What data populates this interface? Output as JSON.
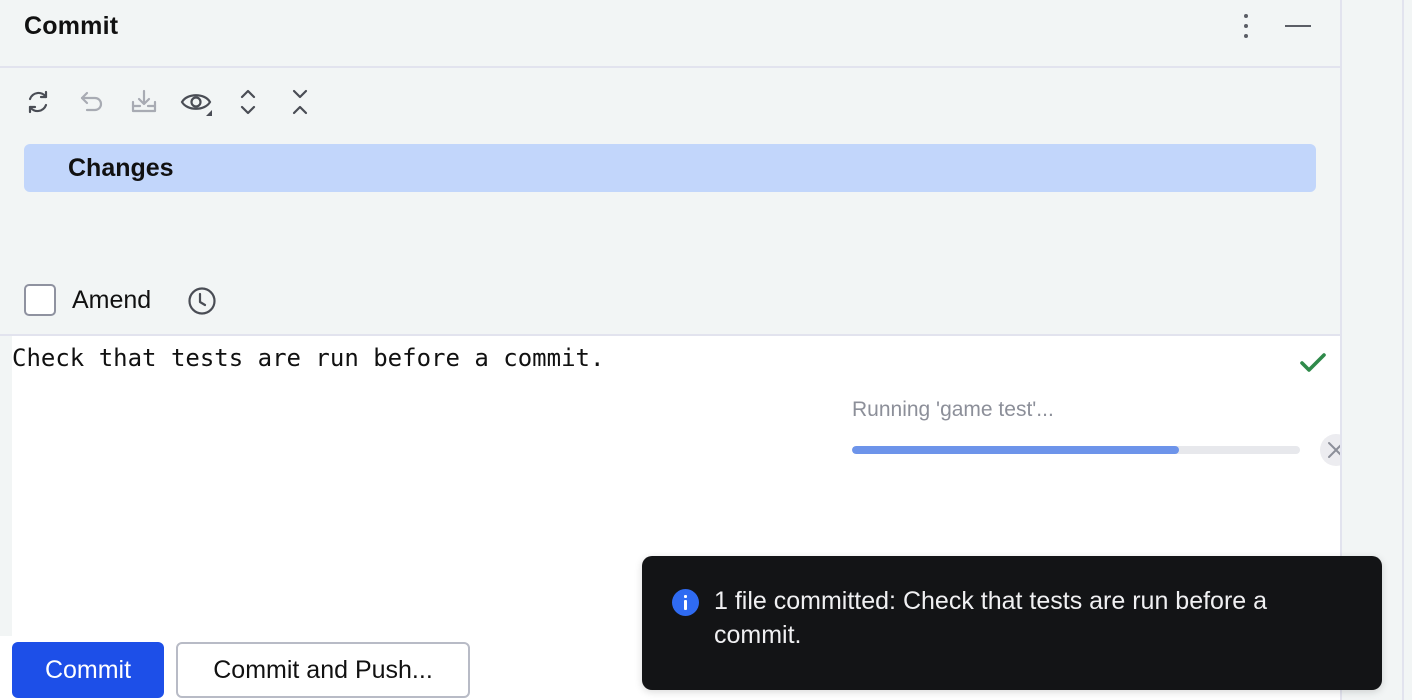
{
  "header": {
    "title": "Commit",
    "more_icon": "more-vertical-icon",
    "minimize_icon": "minimize-icon"
  },
  "toolbar": {
    "buttons": [
      {
        "name": "refresh",
        "icon": "refresh-icon",
        "enabled": true
      },
      {
        "name": "rollback",
        "icon": "undo-icon",
        "enabled": false
      },
      {
        "name": "shelve",
        "icon": "download-tray-icon",
        "enabled": false
      },
      {
        "name": "view-options",
        "icon": "eye-icon",
        "enabled": true
      },
      {
        "name": "expand-all",
        "icon": "expand-all-icon",
        "enabled": true
      },
      {
        "name": "collapse-all",
        "icon": "collapse-all-icon",
        "enabled": true
      }
    ]
  },
  "changes": {
    "label": "Changes"
  },
  "amend": {
    "label": "Amend",
    "checked": false,
    "history_icon": "clock-icon"
  },
  "message": {
    "text": "Check that tests are run before a commit.",
    "status_icon": "check-icon"
  },
  "progress": {
    "label": "Running 'game test'...",
    "value": 0.73,
    "cancel_icon": "close-icon"
  },
  "buttons": {
    "commit": "Commit",
    "commit_and_push": "Commit and Push..."
  },
  "notification": {
    "icon": "info-icon",
    "text": "1 file committed: Check that tests are run before a commit."
  },
  "colors": {
    "primary": "#1d4fe8",
    "selection": "#c2d6fb",
    "progress": "#6d94ea",
    "success": "#2f8a4a",
    "toast_bg": "#131416",
    "info": "#2f6bf2"
  }
}
